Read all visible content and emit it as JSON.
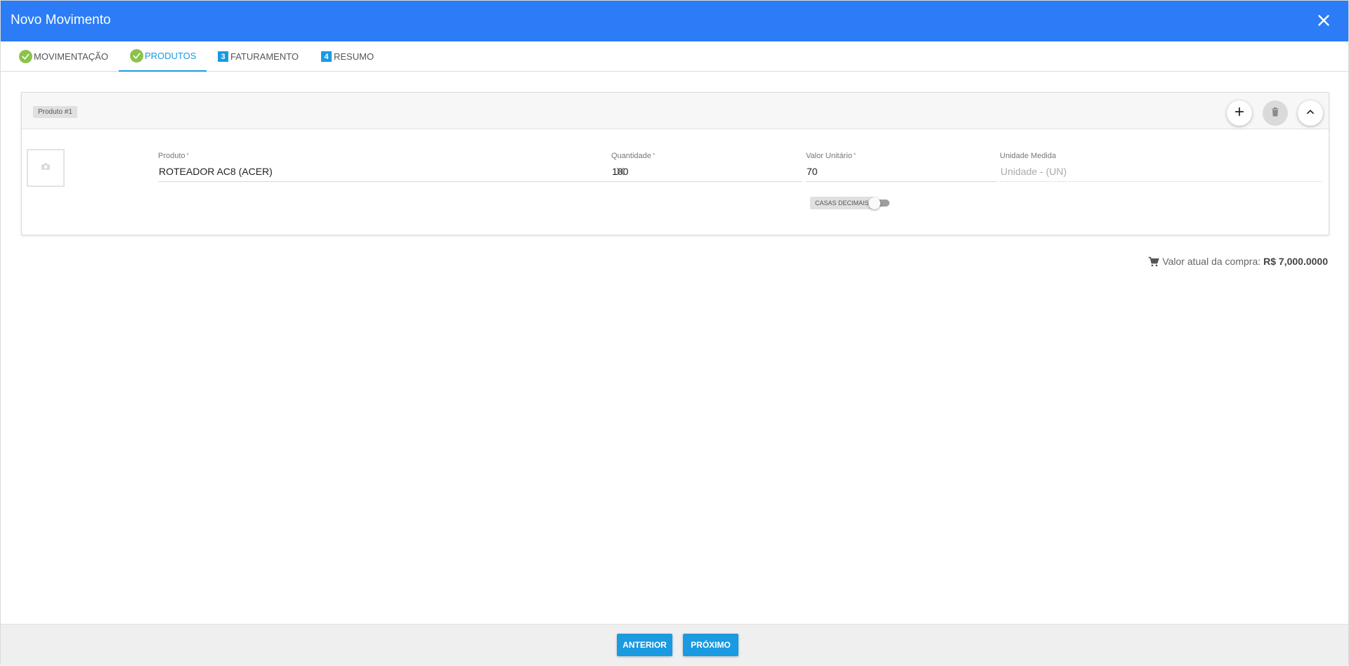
{
  "header": {
    "title": "Novo Movimento",
    "close_icon": "close-icon"
  },
  "tabs": [
    {
      "label": "MOVIMENTAÇÃO",
      "marker": "check",
      "active": false
    },
    {
      "label": "PRODUTOS",
      "marker": "check",
      "active": true
    },
    {
      "label": "FATURAMENTO",
      "marker": "3",
      "active": false
    },
    {
      "label": "RESUMO",
      "marker": "4",
      "active": false
    }
  ],
  "product_card": {
    "badge": "Produto #1",
    "actions": [
      "add-icon",
      "delete-icon",
      "chevron-up-icon"
    ],
    "fields": {
      "produto": {
        "label": "Produto",
        "required": "*",
        "value": "ROTEADOR AC8 (ACER)"
      },
      "quantidade": {
        "label": "Quantidade",
        "required": "*",
        "value": "100"
      },
      "valor_unitario": {
        "label": "Valor Unitário",
        "required": "*",
        "value": "70"
      },
      "unidade_medida": {
        "label": "Unidade Medida",
        "value": "Unidade - (UN)"
      }
    },
    "casas_decimais": {
      "label": "CASAS DECIMAIS",
      "enabled": false
    }
  },
  "summary": {
    "label": "Valor atual da compra:",
    "amount": "R$ 7,000.0000"
  },
  "footer": {
    "previous_label": "ANTERIOR",
    "next_label": "PRÓXIMO"
  },
  "colors": {
    "primary": "#2b7cf6",
    "accent": "#1a9ae0",
    "success": "#8bc34a"
  }
}
